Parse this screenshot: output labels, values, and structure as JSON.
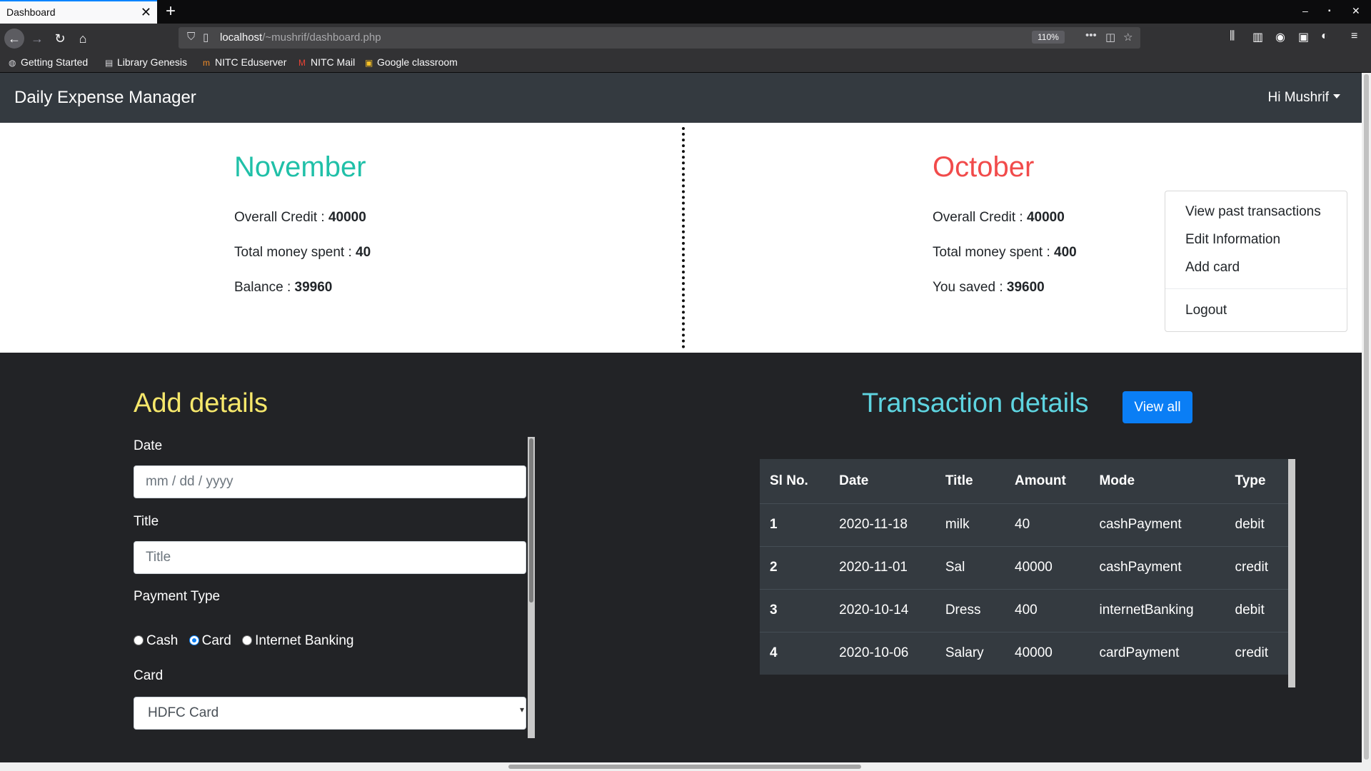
{
  "browser": {
    "tab_title": "Dashboard",
    "tab_close": "✕",
    "new_tab": "+",
    "url_host": "localhost",
    "url_path": "/~mushrif/dashboard.php",
    "zoom": "110%",
    "bookmarks": [
      "Getting Started",
      "Library Genesis",
      "NITC Eduserver",
      "NITC Mail",
      "Google classroom"
    ]
  },
  "app": {
    "brand": "Daily Expense Manager",
    "user_greeting": "Hi Mushrif",
    "user_menu": [
      "View past transactions",
      "Edit Information",
      "Add card",
      "Logout"
    ]
  },
  "summary": {
    "current": {
      "month": "November",
      "credit_label": "Overall Credit :",
      "credit_value": "40000",
      "spent_label": "Total money spent :",
      "spent_value": "40",
      "balance_label": "Balance :",
      "balance_value": "39960",
      "color": "#20c0a8"
    },
    "previous": {
      "month": "October",
      "credit_label": "Overall Credit :",
      "credit_value": "40000",
      "spent_label": "Total money spent :",
      "spent_value": "400",
      "saved_label": "You saved :",
      "saved_value": "39600",
      "color": "#f14b4b"
    }
  },
  "add_details": {
    "heading": "Add details",
    "date_label": "Date",
    "date_placeholder": "mm / dd / yyyy",
    "title_label": "Title",
    "title_placeholder": "Title",
    "payment_type_label": "Payment Type",
    "payment_options": [
      "Cash",
      "Card",
      "Internet Banking"
    ],
    "payment_selected": "Card",
    "card_label": "Card",
    "card_selected": "HDFC Card"
  },
  "transactions": {
    "heading": "Transaction details",
    "view_all": "View all",
    "columns": [
      "Sl No.",
      "Date",
      "Title",
      "Amount",
      "Mode",
      "Type"
    ],
    "rows": [
      [
        "1",
        "2020-11-18",
        "milk",
        "40",
        "cashPayment",
        "debit"
      ],
      [
        "2",
        "2020-11-01",
        "Sal",
        "40000",
        "cashPayment",
        "credit"
      ],
      [
        "3",
        "2020-10-14",
        "Dress",
        "400",
        "internetBanking",
        "debit"
      ],
      [
        "4",
        "2020-10-06",
        "Salary",
        "40000",
        "cardPayment",
        "credit"
      ]
    ]
  },
  "colors": {
    "add_heading": "#f6e76b",
    "tx_heading": "#5ed4e0",
    "button": "#0a7ef5",
    "navbar": "#343a40"
  }
}
